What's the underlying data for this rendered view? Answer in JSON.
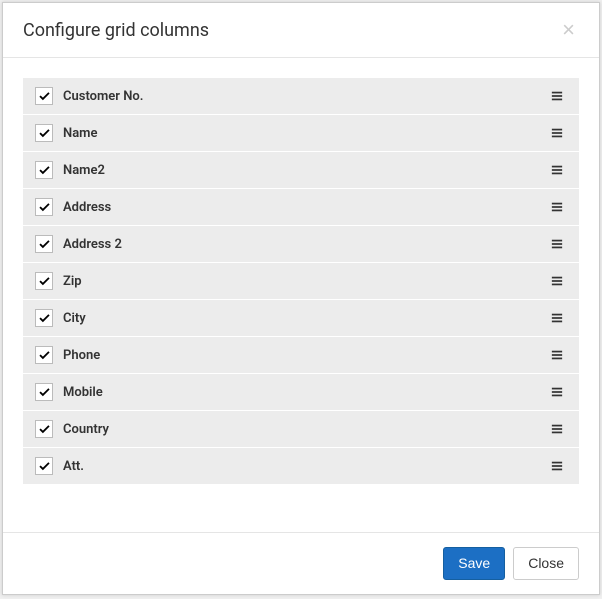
{
  "dialog": {
    "title": "Configure grid columns",
    "close_label": "×"
  },
  "columns": [
    {
      "label": "Customer No.",
      "checked": true
    },
    {
      "label": "Name",
      "checked": true
    },
    {
      "label": "Name2",
      "checked": true
    },
    {
      "label": "Address",
      "checked": true
    },
    {
      "label": "Address 2",
      "checked": true
    },
    {
      "label": "Zip",
      "checked": true
    },
    {
      "label": "City",
      "checked": true
    },
    {
      "label": "Phone",
      "checked": true
    },
    {
      "label": "Mobile",
      "checked": true
    },
    {
      "label": "Country",
      "checked": true
    },
    {
      "label": "Att.",
      "checked": true
    }
  ],
  "footer": {
    "save_label": "Save",
    "close_label": "Close"
  }
}
